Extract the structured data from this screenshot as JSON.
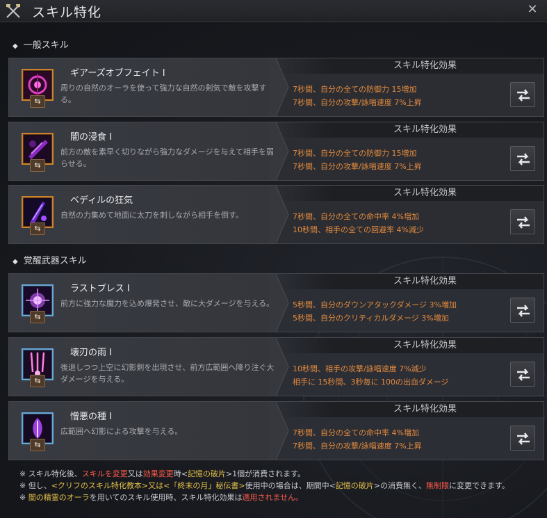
{
  "window": {
    "title": "スキル特化",
    "close_glyph": "✕"
  },
  "sections": {
    "general": "一般スキル",
    "awakening": "覚醒武器スキル"
  },
  "effect_header": "スキル特化効果",
  "skills": [
    {
      "name": "ギアーズオブフェイト I",
      "desc": "周りの自然のオーラを使って強力な自然の剣気で敵を攻撃する。",
      "effects": [
        "7秒間、自分の全ての防御力 15増加",
        "7秒間、自分の攻撃/詠唱速度 7%上昇"
      ],
      "icon": "gears-of-fate-icon"
    },
    {
      "name": "闇の浸食 I",
      "desc": "前方の敵を素早く切りながら強力なダメージを与えて相手を弱らせる。",
      "effects": [
        "7秒間、自分の全ての防御力 15増加",
        "7秒間、自分の攻撃/詠唱速度 7%上昇"
      ],
      "icon": "dark-erosion-icon"
    },
    {
      "name": "ベディルの狂気",
      "desc": "自然の力集めて地面に太刀を刺しながら相手を倒す。",
      "effects": [
        "7秒間、自分の全ての命中率 4%増加",
        "10秒間、相手の全ての回避率 4%減少"
      ],
      "icon": "bedir-madness-icon"
    },
    {
      "name": "ラストブレス I",
      "desc": "前方に強力な魔力を込め爆発させ、敵に大ダメージを与える。",
      "effects": [
        "5秒間、自分のダウンアタックダメージ 3%増加",
        "5秒間、自分のクリティカルダメージ 3%増加"
      ],
      "icon": "last-breath-icon"
    },
    {
      "name": "壊刃の雨 I",
      "desc": "後退しつつ上空に幻影剣を出現させ、前方広範囲へ降り注ぐ大ダメージを与える。",
      "effects": [
        "10秒間、相手の攻撃/詠唱速度 7%減少",
        "相手に 15秒間、3秒毎に 100の出血ダメージ"
      ],
      "icon": "broken-blade-rain-icon"
    },
    {
      "name": "憎悪の種 I",
      "desc": "広範囲へ幻影による攻撃を与える。",
      "effects": [
        "7秒間、自分の全ての命中率 4%増加",
        "7秒間、自分の攻撃/詠唱速度 7%上昇"
      ],
      "icon": "seed-of-hatred-icon"
    }
  ],
  "notes": {
    "n1": [
      "※ スキル特化後、",
      "スキルを変更",
      "又は",
      "効果変更",
      "時<",
      "記憶の破片",
      ">1個が消費されます。"
    ],
    "n2": [
      "※ 但し、",
      "<クリフのスキル特化教本>又は<「終末の月」秘伝書>",
      "使用中の場合は、期間中<",
      "記憶の破片",
      ">の消費無く、",
      "無制限",
      "に変更できます。"
    ],
    "n3": [
      "※ ",
      "闇の精霊のオーラ",
      "を用いてのスキル使用時、スキル特化効果は",
      "適用されません。"
    ]
  },
  "colors": {
    "effect_text": "#e38a3c",
    "warning": "#ff5a4a",
    "highlight": "#e6c24a"
  }
}
